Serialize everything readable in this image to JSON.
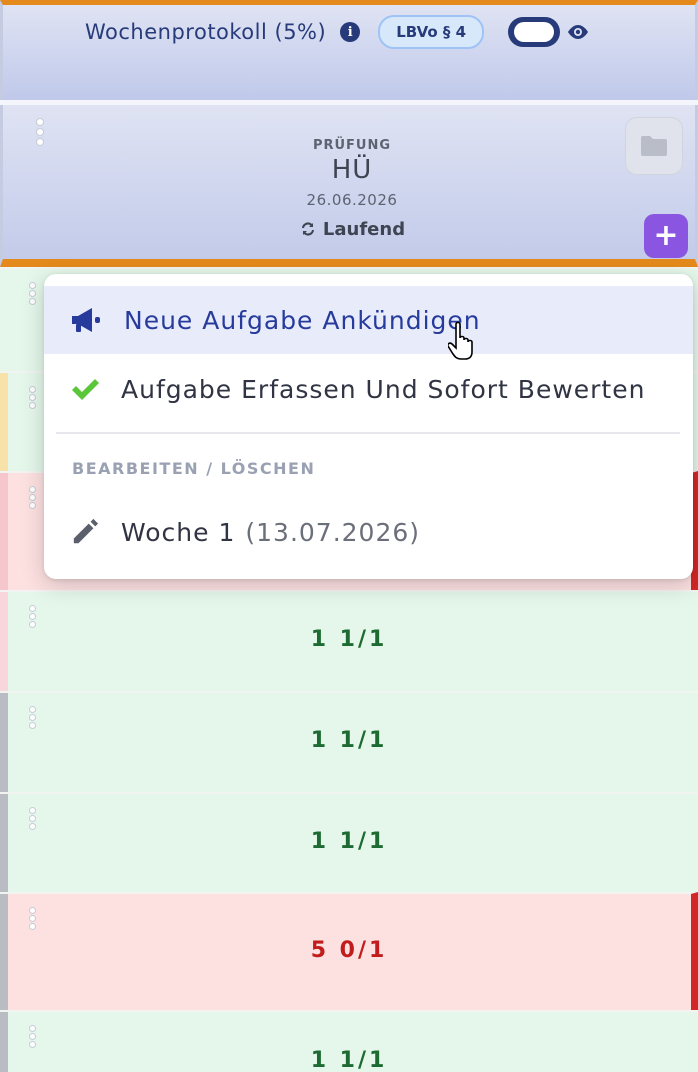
{
  "header": {
    "title": "Wochenprotokoll (5%)",
    "info_icon": "info-circle-icon",
    "badge": "LBVo § 4",
    "toggle_icon": "toggle-switch-icon",
    "visibility_icon": "eye-icon"
  },
  "exam": {
    "kind": "PRÜFUNG",
    "name": "HÜ",
    "date": "26.06.2026",
    "status": "Laufend",
    "status_icon": "refresh-icon",
    "folder_icon": "folder-icon",
    "add_label": "+"
  },
  "menu": {
    "announce_label": "Neue Aufgabe Ankündigen",
    "announce_icon": "megaphone-icon",
    "grade_label": "Aufgabe Erfassen Und Sofort Bewerten",
    "grade_icon": "checkmark-icon",
    "section_label": "BEARBEITEN / LÖSCHEN",
    "edit_label_main": "Woche 1",
    "edit_label_sub": "(13.07.2026)",
    "edit_icon": "pencil-icon"
  },
  "rows": [
    {
      "score": "1 1/1",
      "state": "green"
    },
    {
      "score": "1 1/1",
      "state": "green"
    },
    {
      "score": "1 1/1",
      "state": "green"
    },
    {
      "score": "5 0/1",
      "state": "red"
    },
    {
      "score": "1 1/1",
      "state": "green"
    }
  ],
  "colors": {
    "accent_orange": "#e48a1c",
    "primary_navy": "#273b7a",
    "add_button_purple": "#8a55e0",
    "score_green": "#1d6b32",
    "score_red": "#c11d1d"
  }
}
